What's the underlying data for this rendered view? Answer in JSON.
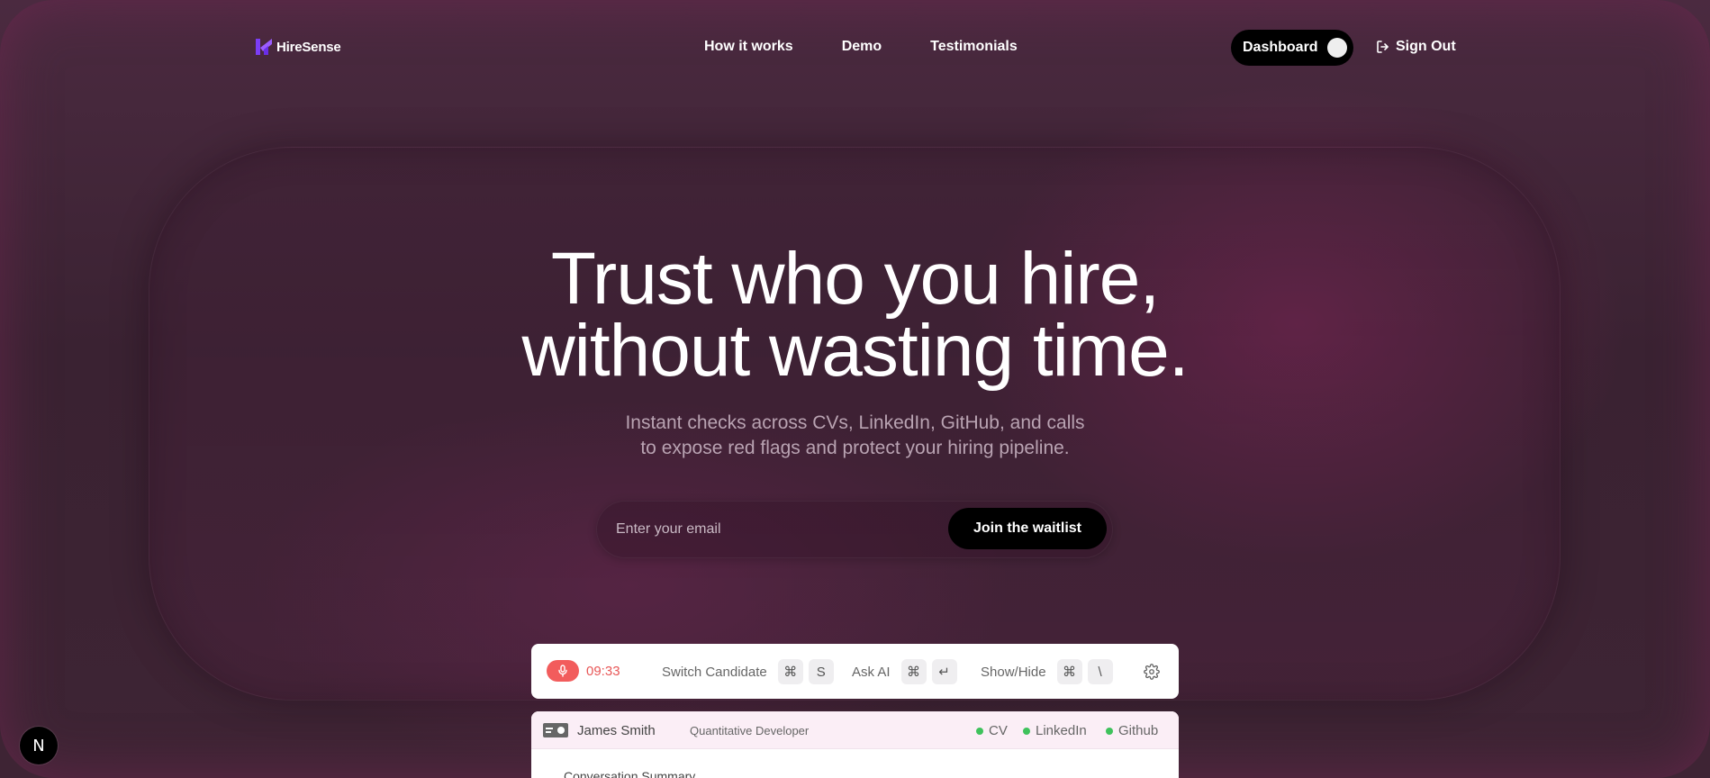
{
  "brand": {
    "name": "HireSense"
  },
  "nav": {
    "links": [
      "How it works",
      "Demo",
      "Testimonials"
    ],
    "dashboard_label": "Dashboard",
    "signout_label": "Sign Out"
  },
  "hero": {
    "title_line1": "Trust who you hire,",
    "title_line2": "without wasting time.",
    "subtitle_line1": "Instant checks across CVs, LinkedIn, GitHub, and calls",
    "subtitle_line2": "to expose red flags and protect your hiring pipeline."
  },
  "waitlist": {
    "placeholder": "Enter your email",
    "button_label": "Join the waitlist"
  },
  "toolbar": {
    "timer": "09:33",
    "switch_label": "Switch Candidate",
    "switch_keys": [
      "⌘",
      "S"
    ],
    "ask_label": "Ask AI",
    "ask_keys": [
      "⌘",
      "↵"
    ],
    "show_label": "Show/Hide",
    "show_keys": [
      "⌘",
      "\\"
    ]
  },
  "candidate": {
    "name": "James Smith",
    "role": "Quantitative Developer",
    "sources": [
      "CV",
      "LinkedIn",
      "Github"
    ],
    "section_title": "Conversation Summary"
  },
  "badge": {
    "letter": "N"
  },
  "colors": {
    "accent_red": "#f25c5c",
    "status_green": "#3fc25c",
    "logo_purple": "#7b3df5"
  }
}
